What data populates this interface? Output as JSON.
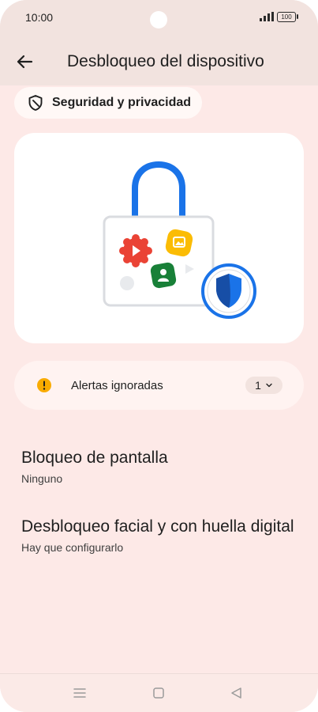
{
  "status_bar": {
    "time": "10:00",
    "battery": "100"
  },
  "header": {
    "title": "Desbloqueo del dispositivo"
  },
  "chip": {
    "label": "Seguridad y privacidad",
    "icon": "shield-outline-icon"
  },
  "illustration": {
    "icon": "lock-illustration"
  },
  "alerts": {
    "label": "Alertas ignoradas",
    "count": "1",
    "icon": "warning-icon"
  },
  "settings": [
    {
      "title": "Bloqueo de pantalla",
      "subtitle": "Ninguno"
    },
    {
      "title": "Desbloqueo facial y con huella digital",
      "subtitle": "Hay que configurarlo"
    }
  ],
  "nav": {
    "menu_icon": "menu-icon",
    "home_icon": "home-icon",
    "back_icon": "back-triangle-icon"
  },
  "colors": {
    "background": "#fde9e7",
    "header": "#f2e3df",
    "accent_blue": "#1a73e8",
    "warning_yellow": "#f9ab00"
  }
}
